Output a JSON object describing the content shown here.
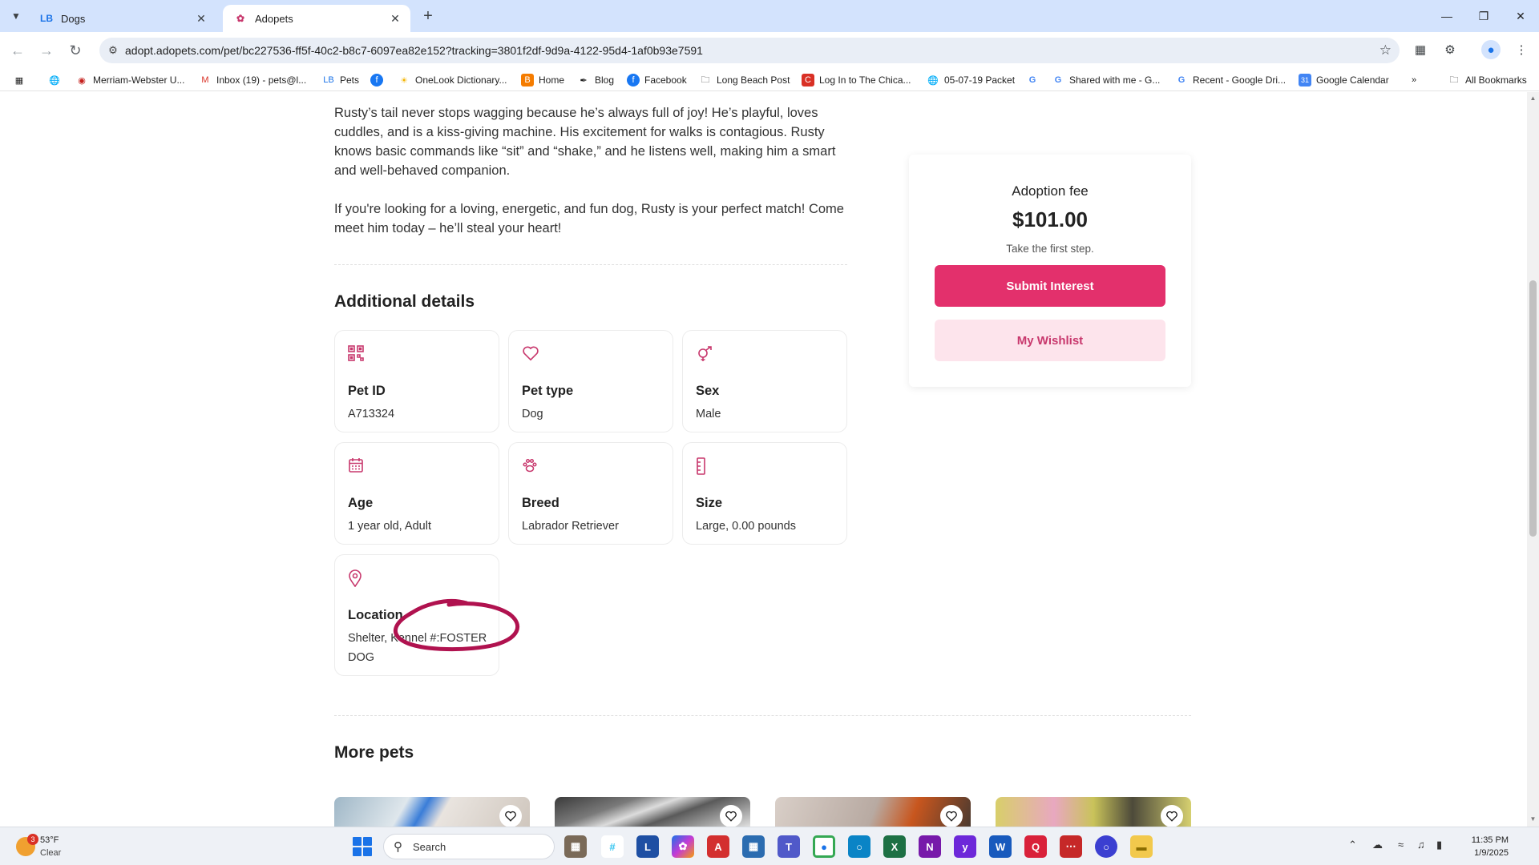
{
  "browser": {
    "tabs": [
      {
        "title": "Dogs",
        "favicon": "LB",
        "active": false
      },
      {
        "title": "Adopets",
        "favicon": "paw",
        "active": true
      }
    ],
    "url": "adopt.adopets.com/pet/bc227536-ff5f-40c2-b8c7-6097ea82e152?tracking=3801f2df-9d9a-4122-95d4-1af0b93e7591",
    "bookmarks": [
      "Merriam-Webster U...",
      "Inbox (19) - pets@l...",
      "Pets",
      "OneLook Dictionary...",
      "Home",
      "Blog",
      "Facebook",
      "Long Beach Post",
      "Log In to The Chica...",
      "05-07-19 Packet",
      "Shared with me - G...",
      "Recent - Google Dri...",
      "Google Calendar"
    ],
    "all_bookmarks": "All Bookmarks"
  },
  "pet": {
    "description_1": "Rusty’s tail never stops wagging because he’s always full of joy! He’s playful, loves cuddles, and is a kiss-giving machine. His excitement for walks is contagious. Rusty knows basic commands like “sit” and “shake,” and he listens well, making him a smart and well-behaved companion.",
    "description_2": "If you're looking for a loving, energetic, and fun dog, Rusty is your perfect match! Come meet him today – he’ll steal your heart!",
    "details_heading": "Additional details",
    "details": [
      {
        "label": "Pet ID",
        "value": "A713324",
        "icon": "qr-code-icon"
      },
      {
        "label": "Pet type",
        "value": "Dog",
        "icon": "heart-icon"
      },
      {
        "label": "Sex",
        "value": "Male",
        "icon": "gender-icon"
      },
      {
        "label": "Age",
        "value": "1 year old, Adult",
        "icon": "calendar-icon"
      },
      {
        "label": "Breed",
        "value": "Labrador Retriever",
        "icon": "paw-icon"
      },
      {
        "label": "Size",
        "value": "Large, 0.00 pounds",
        "icon": "ruler-icon"
      },
      {
        "label": "Location",
        "value": "Shelter, Kennel #:FOSTER DOG",
        "icon": "location-pin-icon"
      }
    ],
    "more_pets_heading": "More pets"
  },
  "adoption": {
    "fee_label": "Adoption fee",
    "fee_amount": "$101.00",
    "subtitle": "Take the first step.",
    "submit_label": "Submit Interest",
    "wishlist_label": "My Wishlist"
  },
  "colors": {
    "accent": "#e3306c",
    "accent_light": "#fde4ec",
    "annotation": "#b0124f"
  },
  "taskbar": {
    "temperature": "53°F",
    "condition": "Clear",
    "weather_badge": "3",
    "search_placeholder": "Search",
    "time": "11:35 PM",
    "date": "1/9/2025"
  }
}
